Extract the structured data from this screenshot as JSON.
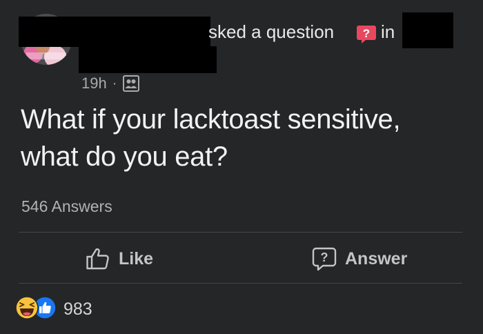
{
  "post": {
    "action": "sked a question",
    "in_word": "in",
    "time": "19h",
    "separator": "·",
    "audience_icon": "group-icon",
    "question_line1": "What if your lacktoast sensitive,",
    "question_line2": "what do you eat?",
    "answers_count": "546 Answers"
  },
  "actions": {
    "like_label": "Like",
    "answer_label": "Answer"
  },
  "reactions": {
    "icons": [
      "haha-reaction-icon",
      "like-reaction-icon"
    ],
    "count": "983"
  },
  "colors": {
    "background": "#252628",
    "question_badge": "#e8485f",
    "like_blue": "#1877f2",
    "haha_yellow": "#f7c33d"
  }
}
